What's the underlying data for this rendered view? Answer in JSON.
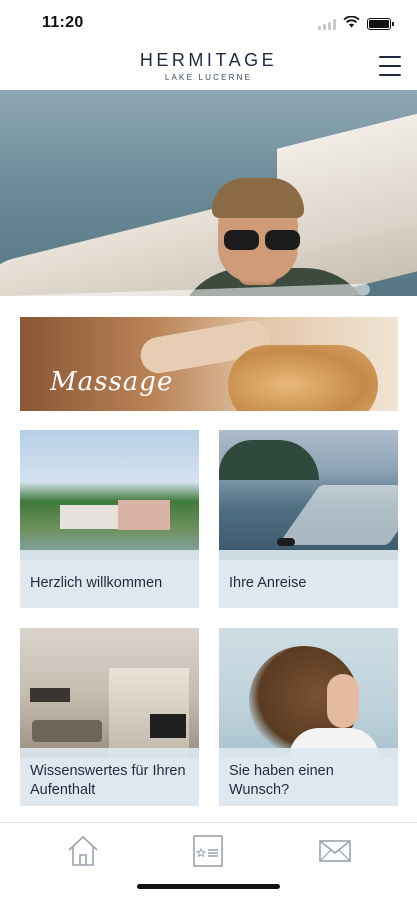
{
  "status_bar": {
    "time": "11:20",
    "icons": [
      "signal-icon",
      "wifi-icon",
      "battery-icon"
    ]
  },
  "header": {
    "brand_name": "HERMITAGE",
    "brand_sub": "LAKE LUCERNE",
    "menu_icon": "hamburger-menu-icon"
  },
  "banner": {
    "label": "Massage"
  },
  "tiles": [
    {
      "label": "Herzlich willkommen"
    },
    {
      "label": "Ihre Anreise"
    },
    {
      "label": "Wissenswertes für Ihren Aufenthalt"
    },
    {
      "label": "Sie haben einen Wunsch?"
    }
  ],
  "tabbar": {
    "items": [
      {
        "icon": "home-icon"
      },
      {
        "icon": "card-star-icon"
      },
      {
        "icon": "mail-icon"
      }
    ]
  },
  "colors": {
    "brand_text": "#1d2a3f",
    "caption_bg": "#dce6ee",
    "tab_icon": "#9aa3ad"
  }
}
